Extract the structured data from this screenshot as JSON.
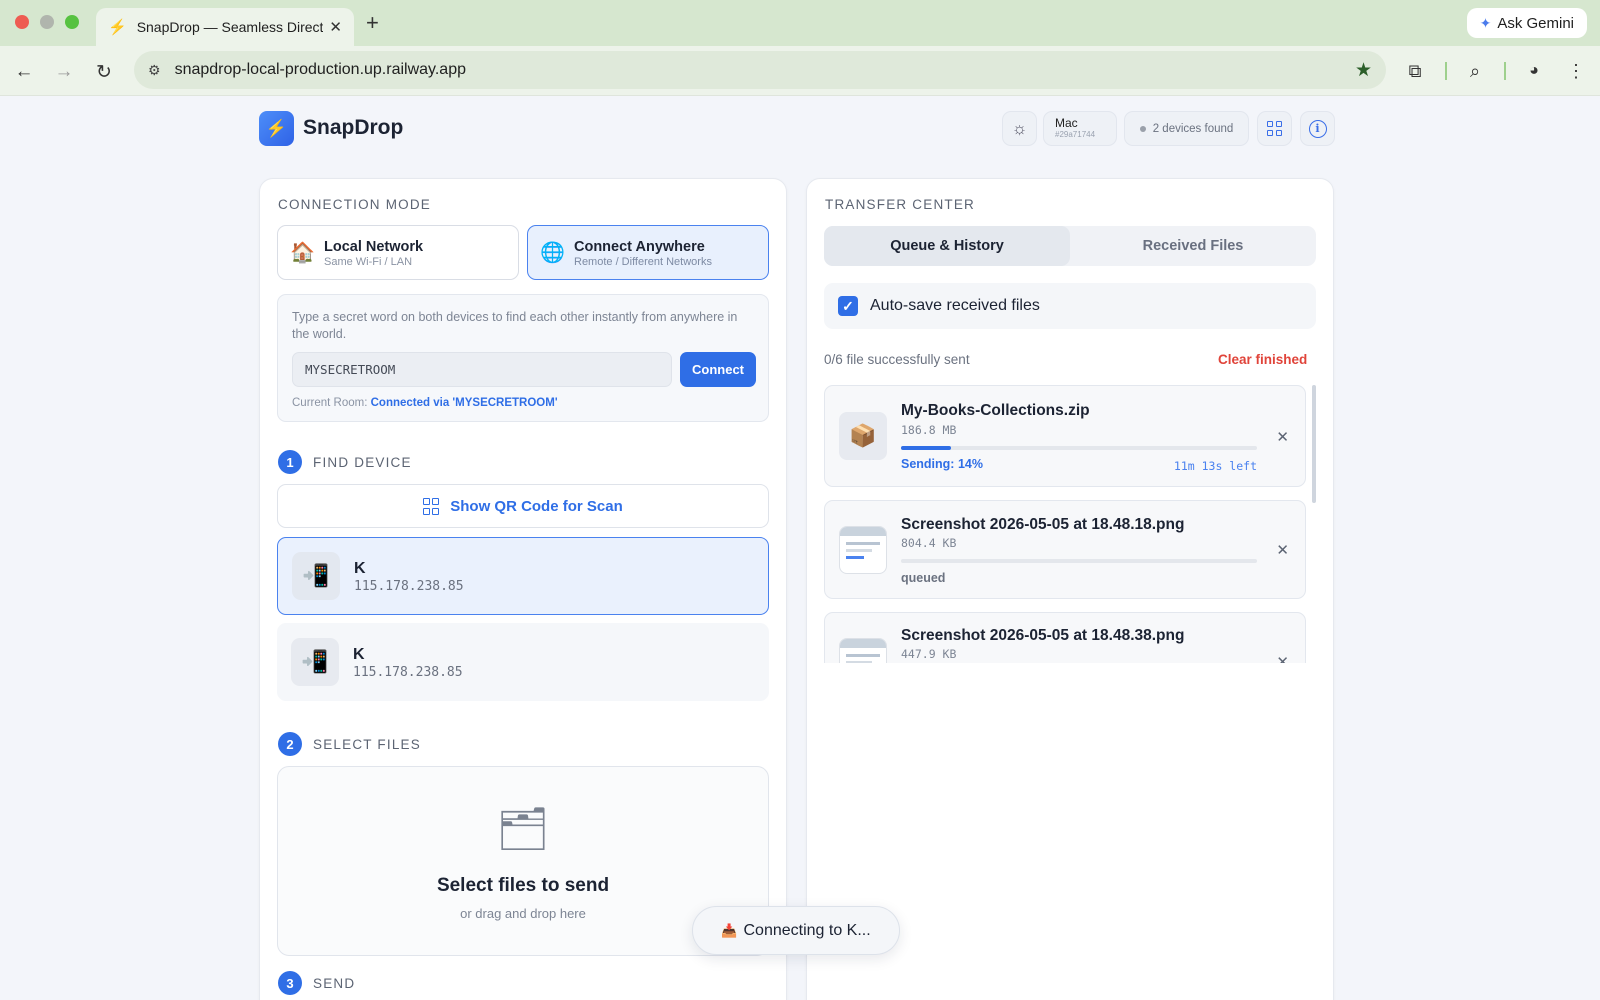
{
  "browser": {
    "tab_title": "SnapDrop — Seamless Direct",
    "url": "snapdrop-local-production.up.railway.app",
    "gemini_label": "Ask Gemini"
  },
  "app": {
    "name": "SnapDrop",
    "device_name": "Mac",
    "device_id": "#29a71744",
    "devices_found": "2 devices found"
  },
  "connection": {
    "section_title": "CONNECTION MODE",
    "modes": [
      {
        "title": "Local Network",
        "subtitle": "Same Wi-Fi / LAN",
        "icon": "house-icon",
        "active": false
      },
      {
        "title": "Connect Anywhere",
        "subtitle": "Remote / Different Networks",
        "icon": "globe-icon",
        "active": true
      }
    ],
    "hint": "Type a secret word on both devices to find each other instantly from anywhere in the world.",
    "room_value": "MYSECRETROOM",
    "connect_label": "Connect",
    "current_room_label": "Current Room:",
    "current_room_value": "Connected via 'MYSECRETROOM'"
  },
  "steps": {
    "find": {
      "num": "1",
      "title": "FIND DEVICE"
    },
    "select": {
      "num": "2",
      "title": "SELECT FILES"
    },
    "send": {
      "num": "3",
      "title": "SEND"
    }
  },
  "qr_button": "Show QR Code for Scan",
  "devices": [
    {
      "name": "K",
      "ip": "115.178.238.85",
      "selected": true
    },
    {
      "name": "K",
      "ip": "115.178.238.85",
      "selected": false
    }
  ],
  "dropzone": {
    "title": "Select files to send",
    "subtitle": "or drag and drop here"
  },
  "transfer": {
    "section_title": "TRANSFER CENTER",
    "tabs": [
      "Queue & History",
      "Received Files"
    ],
    "active_tab": 0,
    "autosave_label": "Auto-save received files",
    "autosave_checked": true,
    "sent_summary": "0/6 file successfully sent",
    "clear_label": "Clear finished",
    "queue": [
      {
        "name": "My-Books-Collections.zip",
        "size": "186.8 MB",
        "status": "Sending: 14%",
        "progress": 0.14,
        "eta": "11m 13s left",
        "thumb": "package-icon"
      },
      {
        "name": "Screenshot 2026-05-05 at 18.48.18.png",
        "size": "804.4 KB",
        "status": "queued",
        "progress": 0,
        "eta": "",
        "thumb": "image-thumbnail"
      },
      {
        "name": "Screenshot 2026-05-05 at 18.48.38.png",
        "size": "447.9 KB",
        "status": "",
        "progress": 0,
        "eta": "",
        "thumb": "image-thumbnail"
      }
    ]
  },
  "toast": {
    "icon": "inbox-tray-icon",
    "text": "Connecting to K..."
  },
  "colors": {
    "accent": "#2f6ee6",
    "danger": "#e0443a",
    "chrome": "#d6e7cf"
  }
}
